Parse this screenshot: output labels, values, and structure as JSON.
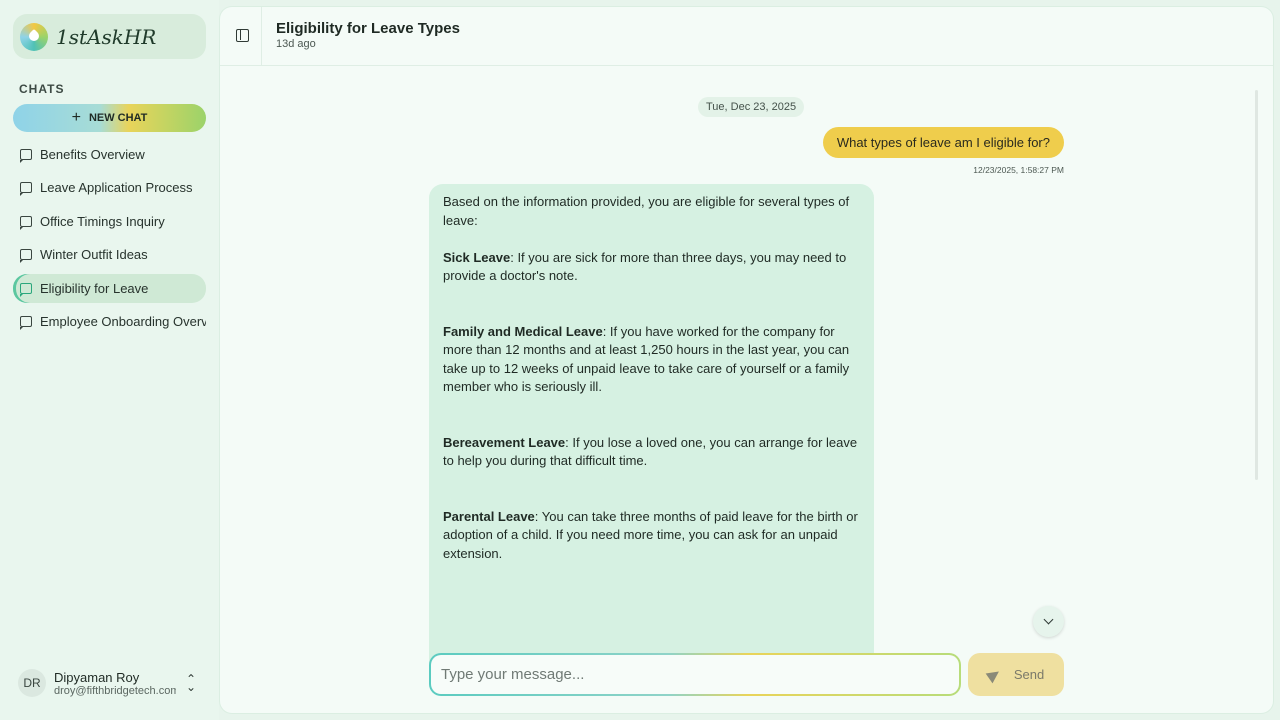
{
  "app": {
    "name": "1stAskHR"
  },
  "sidebar": {
    "section_label": "CHATS",
    "new_chat_label": "NEW CHAT",
    "items": [
      {
        "label": "Benefits Overview"
      },
      {
        "label": "Leave Application Process"
      },
      {
        "label": "Office Timings Inquiry"
      },
      {
        "label": "Winter Outfit Ideas"
      },
      {
        "label": "Eligibility for Leave",
        "active": true
      },
      {
        "label": "Employee Onboarding Overview"
      }
    ],
    "user": {
      "initials": "DR",
      "name": "Dipyaman Roy",
      "email": "droy@fifthbridgetech.com"
    }
  },
  "header": {
    "title": "Eligibility for Leave Types",
    "subtitle": "13d ago"
  },
  "conversation": {
    "date": "Tue, Dec 23, 2025",
    "user_message": {
      "text": "What types of leave am I eligible for?",
      "time": "12/23/2025, 1:58:27 PM"
    },
    "bot_message": {
      "intro": "Based on the information provided, you are eligible for several types of leave:",
      "items": [
        {
          "title": "Sick Leave",
          "text": ": If you are sick for more than three days, you may need to provide a doctor's note."
        },
        {
          "title": "Family and Medical Leave",
          "text": ": If you have worked for the company for more than 12 months and at least 1,250 hours in the last year, you can take up to 12 weeks of unpaid leave to take care of yourself or a family member who is seriously ill."
        },
        {
          "title": "Bereavement Leave",
          "text": ": If you lose a loved one, you can arrange for leave to help you during that difficult time."
        },
        {
          "title": "Parental Leave",
          "text": ": You can take three months of paid leave for the birth or adoption of a child. If you need more time, you can ask for an unpaid extension."
        }
      ]
    }
  },
  "composer": {
    "placeholder": "Type your message...",
    "send_label": "Send"
  },
  "colors": {
    "accent_yellow": "#efcd4c",
    "bot_bubble": "#d6f1e2",
    "active_item": "#cfe9d5"
  }
}
